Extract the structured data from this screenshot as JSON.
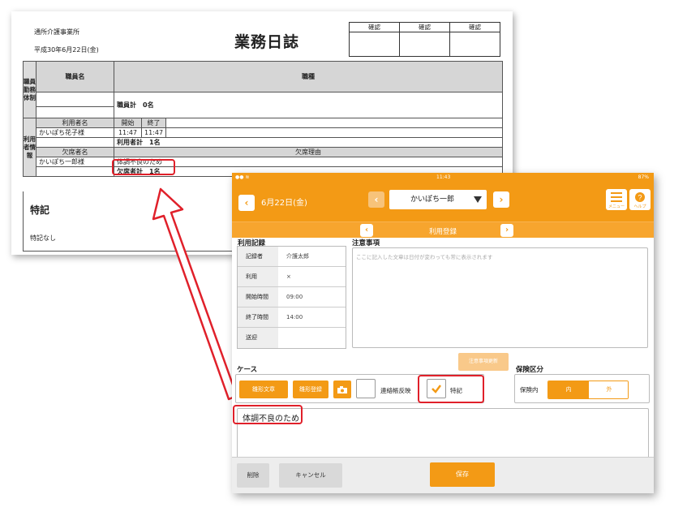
{
  "document": {
    "office": "通所介護事業所",
    "date": "平成30年6月22日(金)",
    "title": "業務日誌",
    "confirm_headers": [
      "確認",
      "確認",
      "確認"
    ],
    "staff_section_label": "職員勤務体制",
    "staff_name_header": "職員名",
    "job_type_header": "職種",
    "staff_total": "職員計　0名",
    "user_section_label": "利用者情報",
    "user_name_header": "利用者名",
    "start_header": "開始",
    "end_header": "終了",
    "user_row": {
      "name": "かいぽち花子様",
      "start": "11:47",
      "end": "11:47"
    },
    "user_total": "利用者計　1名",
    "absent_name_header": "欠席者名",
    "absent_reason_header": "欠席理由",
    "absent_row": {
      "name": "かいぽち一郎様",
      "reason": "体調不良のため"
    },
    "absent_total": "欠席者計　1名",
    "tokki_title": "特記",
    "tokki_text": "特記なし"
  },
  "tablet": {
    "status_time": "11:43",
    "status_battery": "87%",
    "date_label": "6月22日(金)",
    "selected_user": "かいぽち一郎",
    "menu_label": "メニュー",
    "help_label": "ヘルプ",
    "sub_title": "利用登録",
    "usage_record_label": "利用記録",
    "notes_label": "注意事項",
    "notes_placeholder": "ここに記入した文章は日付が変わっても常に表示されます",
    "records": [
      {
        "key": "記録者",
        "value": "介護太郎"
      },
      {
        "key": "利用",
        "value": "×"
      },
      {
        "key": "開始時間",
        "value": "09:00"
      },
      {
        "key": "終了時間",
        "value": "14:00"
      },
      {
        "key": "送迎",
        "value": ""
      }
    ],
    "notes_update_button": "注意事項更新",
    "case_label": "ケース",
    "template_text_button": "雛形文章",
    "template_register_button": "雛形登録",
    "renraku_label": "連絡帳反映",
    "tokki_label": "特記",
    "insurance_label": "保険区分",
    "insurance_in_label": "保険内",
    "insurance_in_option": "内",
    "insurance_out_option": "外",
    "memo_text": "体調不良のため",
    "delete_button": "削除",
    "cancel_button": "キャンセル",
    "save_button": "保存"
  },
  "colors": {
    "accent": "#f39a15",
    "highlight": "#e0202a"
  }
}
